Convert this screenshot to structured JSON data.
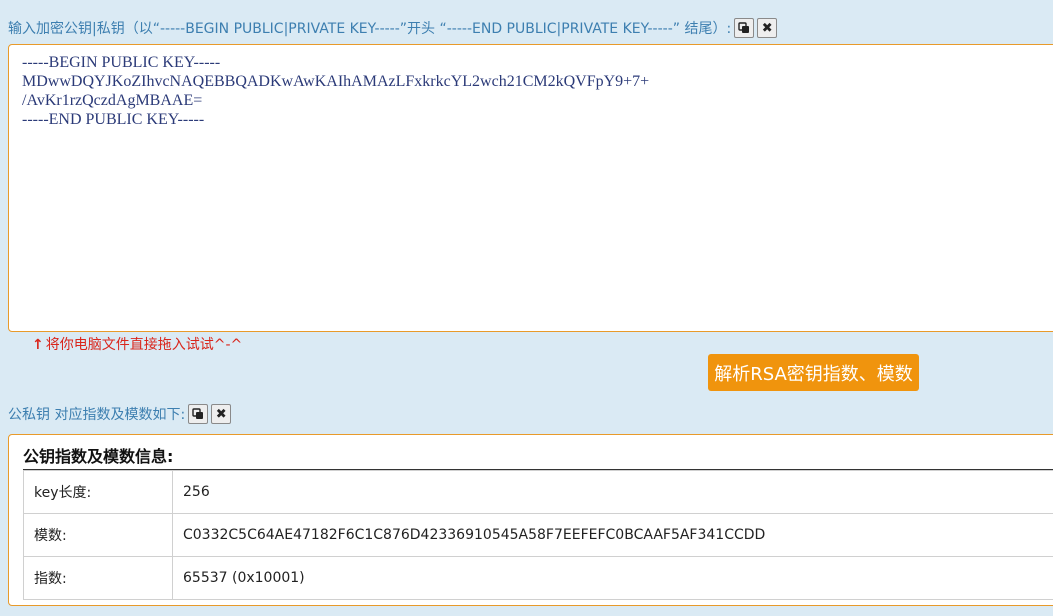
{
  "input_section": {
    "label": "输入加密公钥|私钥（以“-----BEGIN PUBLIC|PRIVATE KEY-----”开头 “-----END PUBLIC|PRIVATE KEY-----” 结尾）:",
    "copy_icon": "copy-icon",
    "clear_icon": "close-icon",
    "key_text": "-----BEGIN PUBLIC KEY-----\nMDwwDQYJKoZIhvcNAQEBBQADKwAwKAIhAMAzLFxkrkcYL2wch21CM2kQVFpY9+7+\n/AvKr1rzQczdAgMBAAE=\n-----END PUBLIC KEY-----"
  },
  "hint": {
    "arrow": "↑",
    "text": "将你电脑文件直接拖入试试^-^"
  },
  "parse_button": {
    "label": "解析RSA密钥指数、模数"
  },
  "output_section": {
    "label": "公私钥 对应指数及模数如下:",
    "copy_icon": "copy-icon",
    "clear_icon": "close-icon"
  },
  "result": {
    "title": "公钥指数及模数信息:",
    "rows": [
      {
        "key": "key长度:",
        "value": "256"
      },
      {
        "key": "模数:",
        "value": "C0332C5C64AE47182F6C1C876D42336910545A58F7EEFEFC0BCAAF5AF341CCDD"
      },
      {
        "key": "指数:",
        "value": "65537 (0x10001)"
      }
    ]
  },
  "colors": {
    "background": "#daeaf4",
    "label": "#3d7fb0",
    "accent": "#f0940d",
    "hint": "#d9261c"
  }
}
